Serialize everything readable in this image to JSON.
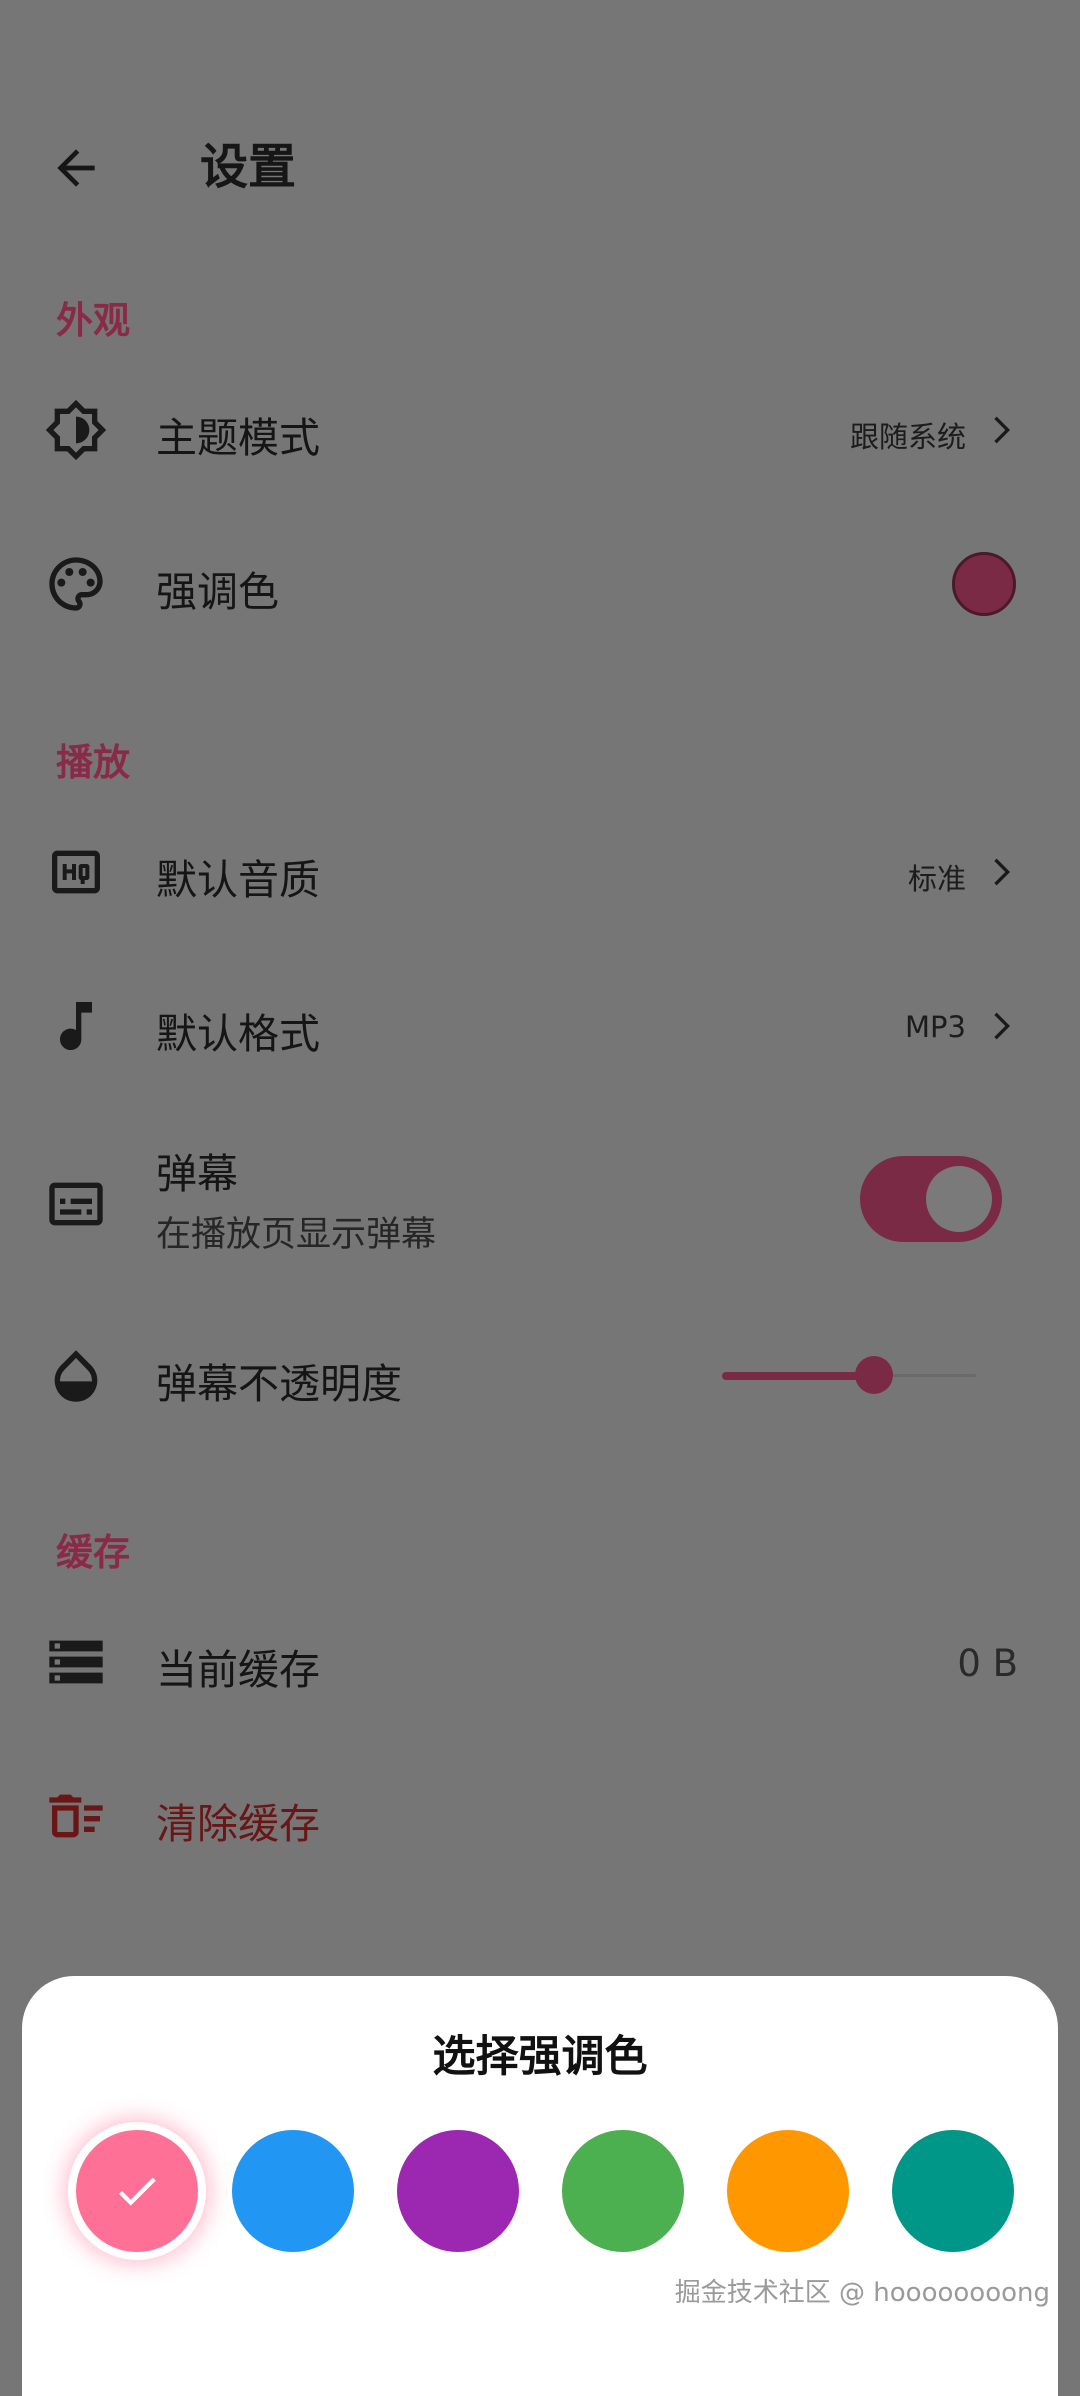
{
  "header": {
    "title": "设置"
  },
  "sections": {
    "appearance": "外观",
    "playback": "播放",
    "cache": "缓存"
  },
  "settings": {
    "theme_mode": {
      "label": "主题模式",
      "value": "跟随系统"
    },
    "accent_color": {
      "label": "强调色",
      "color": "#7a2a45"
    },
    "default_quality": {
      "label": "默认音质",
      "value": "标准"
    },
    "default_format": {
      "label": "默认格式",
      "value": "MP3"
    },
    "danmaku": {
      "label": "弹幕",
      "subtitle": "在播放页显示弹幕",
      "enabled": true
    },
    "danmaku_opacity": {
      "label": "弹幕不透明度",
      "level": 0.6
    },
    "current_cache": {
      "label": "当前缓存",
      "value": "0 B"
    },
    "clear_cache": {
      "label": "清除缓存"
    }
  },
  "picker": {
    "title": "选择强调色",
    "colors": [
      {
        "hex": "#ff7096",
        "selected": true
      },
      {
        "hex": "#2196f3",
        "selected": false
      },
      {
        "hex": "#9c27b0",
        "selected": false
      },
      {
        "hex": "#4caf50",
        "selected": false
      },
      {
        "hex": "#ff9800",
        "selected": false
      },
      {
        "hex": "#009688",
        "selected": false
      }
    ]
  },
  "watermark": "掘金技术社区 @ hoooooooong"
}
